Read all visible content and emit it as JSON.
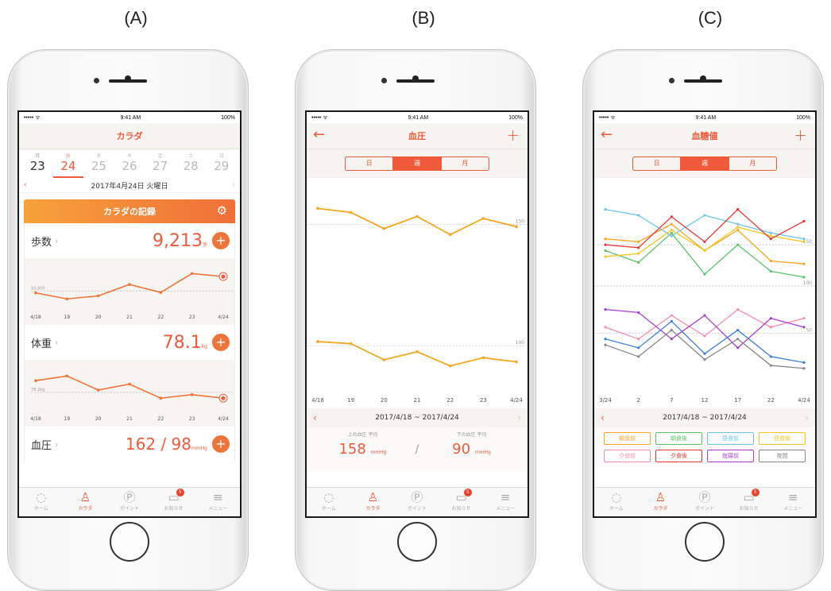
{
  "panel_labels": [
    "(A)",
    "(B)",
    "(C)"
  ],
  "status": {
    "carrier": "••••• ᯤ",
    "time": "9:41 AM",
    "battery": "100%"
  },
  "tabbar": [
    {
      "label": "ホーム",
      "icon": "home-ring-icon"
    },
    {
      "label": "カラダ",
      "icon": "person-icon"
    },
    {
      "label": "ポイント",
      "icon": "point-icon"
    },
    {
      "label": "お知らせ",
      "icon": "message-icon",
      "badge": "5"
    },
    {
      "label": "メニュー",
      "icon": "menu-icon"
    }
  ],
  "segments": [
    "日",
    "週",
    "月"
  ],
  "active_segment": "週",
  "colors": {
    "accent": "#ef5a3b",
    "line_orange": "#f5a623"
  },
  "panelA": {
    "title": "カラダ",
    "days": [
      {
        "wd": "月",
        "dn": "23"
      },
      {
        "wd": "火",
        "dn": "24"
      },
      {
        "wd": "水",
        "dn": "25"
      },
      {
        "wd": "木",
        "dn": "26"
      },
      {
        "wd": "金",
        "dn": "27"
      },
      {
        "wd": "土",
        "dn": "28"
      },
      {
        "wd": "日",
        "dn": "29"
      }
    ],
    "date_line": "2017年4月24日 火曜日",
    "record_header": "カラダの記録",
    "steps": {
      "name": "歩数",
      "value": "9,213",
      "unit": "歩"
    },
    "weight": {
      "name": "体重",
      "value": "78.1",
      "unit": "kg"
    },
    "bp": {
      "name": "血圧",
      "value": "162 / 98",
      "unit": "mmHg"
    },
    "x_labels": [
      "4/18",
      "19",
      "20",
      "21",
      "22",
      "23",
      "4/24"
    ]
  },
  "panelB": {
    "title": "血圧",
    "x_labels": [
      "4/18",
      "19",
      "20",
      "21",
      "22",
      "23",
      "4/24"
    ],
    "range": "2017/4/18 ~ 2017/4/24",
    "upper_label": "上の血圧 平均",
    "upper_value": "158",
    "lower_label": "下の血圧 平均",
    "lower_value": "90",
    "unit": "mmHg",
    "slash": "/"
  },
  "panelC": {
    "title": "血糖値",
    "x_labels": [
      "3/24",
      "2",
      "7",
      "12",
      "17",
      "22",
      "4/24"
    ],
    "range": "2017/4/18 ~ 2017/4/24",
    "tags": [
      {
        "label": "朝食前",
        "color": "#f5a623"
      },
      {
        "label": "朝食後",
        "color": "#5cc46a"
      },
      {
        "label": "昼食前",
        "color": "#6fc3e8"
      },
      {
        "label": "昼食後",
        "color": "#f2c81e"
      },
      {
        "label": "夕食前",
        "color": "#f48fb1"
      },
      {
        "label": "夕食後",
        "color": "#e53935"
      },
      {
        "label": "就寝前",
        "color": "#a63fd0"
      },
      {
        "label": "夜間",
        "color": "#888888"
      }
    ]
  },
  "chart_data": [
    {
      "type": "line",
      "title": "歩数",
      "categories": [
        "4/18",
        "19",
        "20",
        "21",
        "22",
        "23",
        "4/24"
      ],
      "values": [
        9600,
        8400,
        9000,
        11300,
        9700,
        13500,
        12900
      ],
      "ref_label": "10,000",
      "ref_value": 10000,
      "ylim": [
        7000,
        15000
      ]
    },
    {
      "type": "line",
      "title": "体重",
      "categories": [
        "4/18",
        "19",
        "20",
        "21",
        "22",
        "23",
        "4/24"
      ],
      "values": [
        79.6,
        80.0,
        78.8,
        79.3,
        78.1,
        78.4,
        78.1
      ],
      "ref_label": "78.2kg",
      "ref_value": 78.6,
      "ylim": [
        77.3,
        80.7
      ]
    },
    {
      "type": "line",
      "title": "血圧",
      "categories": [
        "4/18",
        "19",
        "20",
        "21",
        "22",
        "23",
        "4/24"
      ],
      "series": [
        {
          "values": [
            168,
            166,
            158,
            164,
            155,
            163,
            159
          ]
        },
        {
          "values": [
            102,
            101,
            93,
            97,
            90,
            94,
            92
          ]
        }
      ],
      "ref_lines": [
        {
          "label": "150",
          "value": 160
        },
        {
          "label": "100",
          "value": 100
        }
      ],
      "ylim": [
        80,
        176
      ]
    },
    {
      "type": "line",
      "title": "血糖値",
      "categories": [
        "3/24",
        "2",
        "7",
        "12",
        "17",
        "22",
        "4/24"
      ],
      "series": [
        {
          "name": "朝食前",
          "color": "#f5a623",
          "values": [
            160,
            158,
            170,
            152,
            166,
            145,
            143
          ]
        },
        {
          "name": "朝食後",
          "color": "#5cc46a",
          "values": [
            152,
            144,
            164,
            136,
            156,
            138,
            134
          ]
        },
        {
          "name": "昼食前",
          "color": "#6fc3e8",
          "values": [
            180,
            176,
            162,
            176,
            170,
            164,
            160
          ]
        },
        {
          "name": "昼食後",
          "color": "#f2c81e",
          "values": [
            148,
            150,
            166,
            152,
            168,
            162,
            158
          ]
        },
        {
          "name": "夕食前",
          "color": "#f48fb1",
          "values": [
            100,
            92,
            108,
            94,
            112,
            100,
            106
          ]
        },
        {
          "name": "夕食後",
          "color": "#e53935",
          "values": [
            156,
            154,
            175,
            158,
            180,
            160,
            172
          ]
        },
        {
          "name": "就寝前",
          "color": "#a63fd0",
          "values": [
            112,
            110,
            92,
            108,
            86,
            106,
            100
          ]
        },
        {
          "name": "夜間",
          "color": "#888888",
          "values": [
            88,
            80,
            98,
            78,
            92,
            74,
            72
          ]
        },
        {
          "name": "",
          "color": "#3b7fd9",
          "values": [
            92,
            86,
            104,
            82,
            98,
            80,
            76
          ]
        }
      ],
      "ref_lines": [
        {
          "label": "150",
          "value": 156
        },
        {
          "label": "100",
          "value": 128
        },
        {
          "label": "50",
          "value": 96
        }
      ],
      "ylim": [
        60,
        196
      ]
    }
  ]
}
